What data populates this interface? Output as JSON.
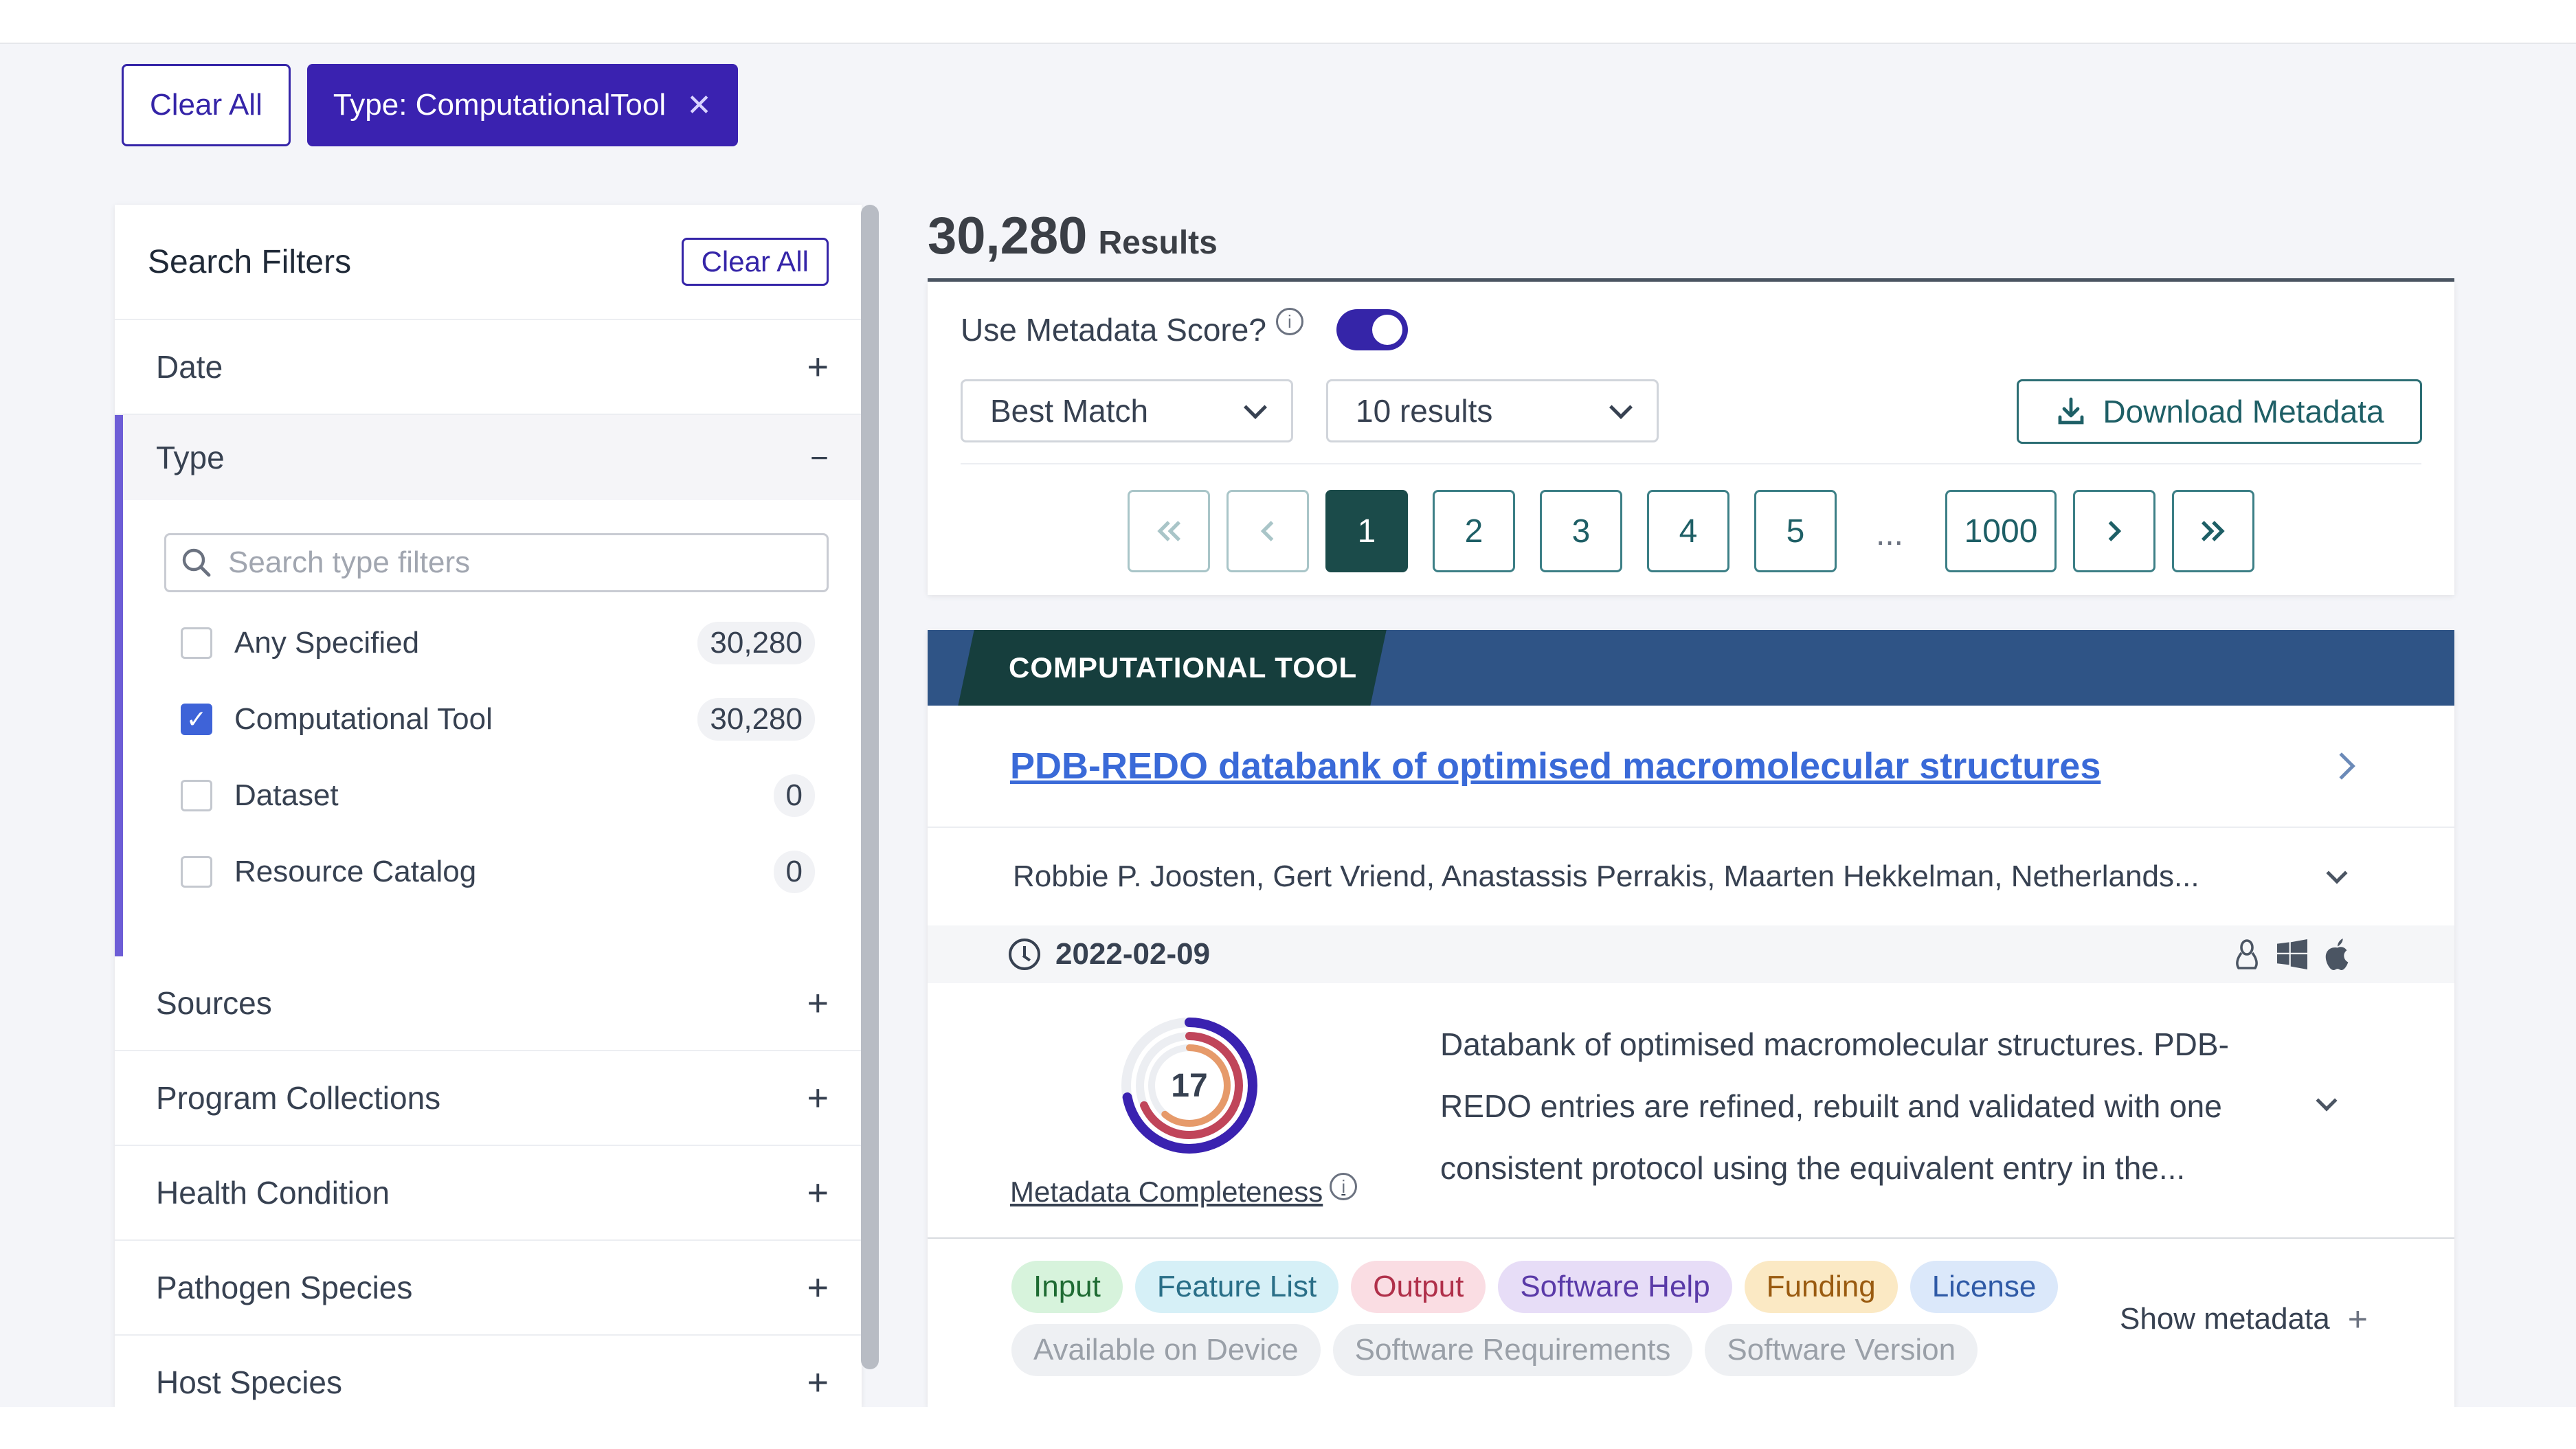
{
  "active_filters": {
    "clear_all": "Clear All",
    "chip": "Type: ComputationalTool",
    "chip_close": "✕"
  },
  "sidebar": {
    "title": "Search Filters",
    "clear_all": "Clear All",
    "sections": {
      "date": "Date",
      "type": "Type",
      "sources": "Sources",
      "program_collections": "Program Collections",
      "health_condition": "Health Condition",
      "pathogen_species": "Pathogen Species",
      "host_species": "Host Species"
    },
    "type_search_placeholder": "Search type filters",
    "type_options": [
      {
        "label": "Any Specified",
        "count": "30,280",
        "checked": false
      },
      {
        "label": "Computational Tool",
        "count": "30,280",
        "checked": true
      },
      {
        "label": "Dataset",
        "count": "0",
        "checked": false
      },
      {
        "label": "Resource Catalog",
        "count": "0",
        "checked": false
      }
    ]
  },
  "results": {
    "count": "30,280",
    "label": "Results",
    "metadata_score_label": "Use Metadata Score?",
    "metadata_score_on": true,
    "sort": "Best Match",
    "per_page": "10 results",
    "download": "Download Metadata",
    "pagination": {
      "pages": [
        "1",
        "2",
        "3",
        "4",
        "5"
      ],
      "ellipsis": "...",
      "last": "1000",
      "current": "1"
    }
  },
  "card": {
    "type": "COMPUTATIONAL TOOL",
    "title": "PDB-REDO databank of optimised macromolecular structures",
    "authors": "Robbie P. Joosten, Gert Vriend, Anastassis Perrakis, Maarten Hekkelman, Netherlands...",
    "date": "2022-02-09",
    "os_icons": [
      "linux-icon",
      "windows-icon",
      "apple-icon"
    ],
    "score": "17",
    "score_fraction": 0.72,
    "metadata_link": "Metadata Completeness",
    "description": "Databank of optimised macromolecular structures. PDB-REDO entries are refined, rebuilt and validated with one consistent protocol using the equivalent entry in the...",
    "tags": [
      {
        "label": "Input",
        "bg": "#d7f3dc",
        "fg": "#1f6b33"
      },
      {
        "label": "Feature List",
        "bg": "#d6f0f7",
        "fg": "#2a6f88"
      },
      {
        "label": "Output",
        "bg": "#fadde3",
        "fg": "#b0304a"
      },
      {
        "label": "Software Help",
        "bg": "#e7ddf7",
        "fg": "#5a3aa8"
      },
      {
        "label": "Funding",
        "bg": "#fbe9c4",
        "fg": "#9a5b10"
      },
      {
        "label": "License",
        "bg": "#dbe8fa",
        "fg": "#2f5aa6"
      },
      {
        "label": "Available on Device",
        "bg": "#eef0f3",
        "fg": "#9aa0a8"
      },
      {
        "label": "Software Requirements",
        "bg": "#eef0f3",
        "fg": "#9aa0a8"
      },
      {
        "label": "Software Version",
        "bg": "#eef0f3",
        "fg": "#9aa0a8"
      }
    ],
    "show_metadata": "Show metadata"
  }
}
